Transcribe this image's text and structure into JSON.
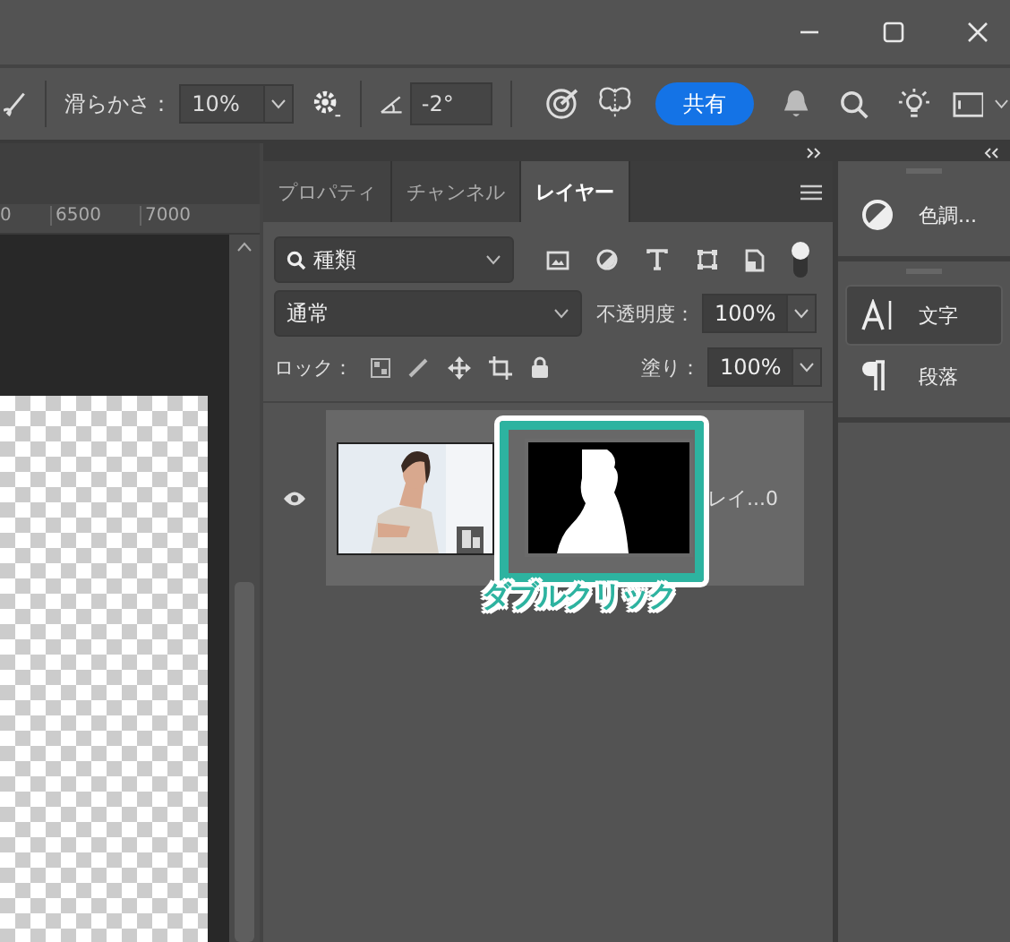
{
  "options_bar": {
    "smoothing_label": "滑らかさ：",
    "smoothing_value": "10%",
    "angle_value": "-2°",
    "share_button": "共有"
  },
  "ruler": {
    "ticks": [
      "0",
      "6500",
      "7000"
    ]
  },
  "layers_panel": {
    "tabs": [
      {
        "label": "プロパティ",
        "selected": false
      },
      {
        "label": "チャンネル",
        "selected": false
      },
      {
        "label": "レイヤー",
        "selected": true
      }
    ],
    "filter": {
      "value": "種類"
    },
    "blend_mode": {
      "value": "通常"
    },
    "opacity": {
      "label": "不透明度：",
      "value": "100%"
    },
    "lock": {
      "label": "ロック："
    },
    "fill": {
      "label": "塗り：",
      "value": "100%"
    },
    "layers": [
      {
        "name": "レイ...0",
        "visible": true,
        "selected": true
      }
    ]
  },
  "annotation": {
    "text": "ダブルクリック"
  },
  "side_panels": [
    {
      "items": [
        {
          "label": "色調...",
          "kind": "adjustments",
          "selected": false
        }
      ]
    },
    {
      "items": [
        {
          "label": "文字",
          "kind": "character",
          "selected": true
        },
        {
          "label": "段落",
          "kind": "paragraph",
          "selected": false
        }
      ]
    }
  ]
}
